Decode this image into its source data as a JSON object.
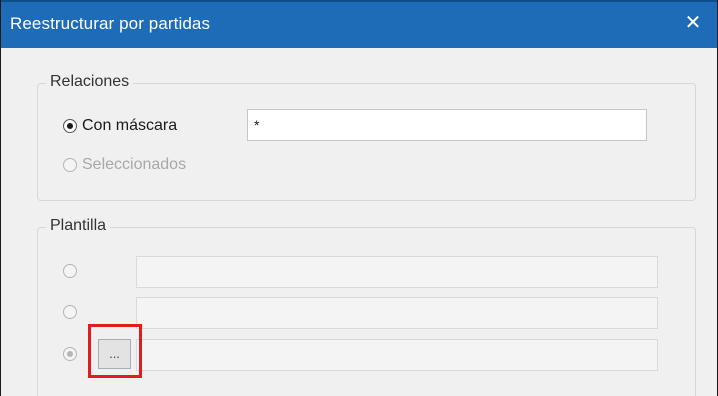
{
  "window": {
    "title": "Reestructurar por partidas",
    "close_glyph": "✕"
  },
  "relaciones": {
    "legend": "Relaciones",
    "options": [
      {
        "label": "Con máscara",
        "checked": true,
        "enabled": true
      },
      {
        "label": "Seleccionados",
        "checked": false,
        "enabled": false
      }
    ],
    "mask_value": "*"
  },
  "plantilla": {
    "legend": "Plantilla",
    "rows": [
      {
        "checked": false,
        "enabled": true,
        "value": ""
      },
      {
        "checked": false,
        "enabled": true,
        "value": ""
      },
      {
        "checked": true,
        "enabled": false,
        "value": ""
      }
    ],
    "browse_label": "...",
    "highlight_color": "#e01d1d"
  },
  "colors": {
    "titlebar": "#1e6bb8",
    "window_bg": "#f0f0f0"
  }
}
